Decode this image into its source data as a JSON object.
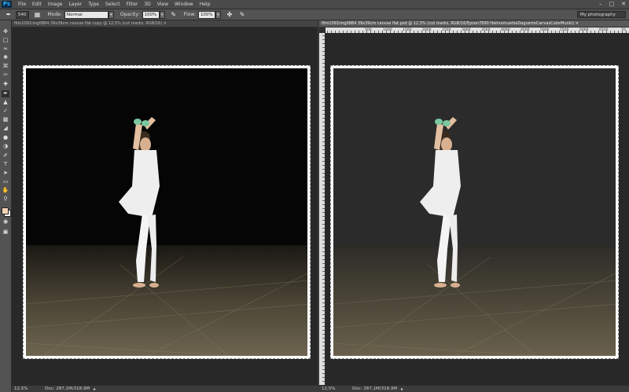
{
  "app": {
    "logo": "Ps"
  },
  "menu": [
    "File",
    "Edit",
    "Image",
    "Layer",
    "Type",
    "Select",
    "Filter",
    "3D",
    "View",
    "Window",
    "Help"
  ],
  "window_controls": [
    "–",
    "□",
    "✕"
  ],
  "options": {
    "brush_size": "540",
    "mode_label": "Mode:",
    "mode_value": "Normal",
    "opacity_label": "Opacity:",
    "opacity_value": "100%",
    "flow_label": "Flow:",
    "flow_value": "100%",
    "workspace": "My photography"
  },
  "tools": [
    "move-icon",
    "marquee-icon",
    "lasso-icon",
    "quick-select-icon",
    "crop-icon",
    "eyedropper-icon",
    "healing-icon",
    "brush-icon",
    "stamp-icon",
    "history-brush-icon",
    "eraser-icon",
    "gradient-icon",
    "blur-icon",
    "dodge-icon",
    "pen-icon",
    "type-icon",
    "path-select-icon",
    "shape-icon",
    "hand-icon",
    "zoom-icon"
  ],
  "documents": [
    {
      "tab": "film1091img0884 39x39cm canvas flat copy @ 12,5% (cut marks, RGB/16) ✕",
      "zoom": "12,5%",
      "doc_info": "Doc: 287,1M/318,9M",
      "dark": true
    },
    {
      "tab": "film1091img0884 39x39cm canvas flat.psd @ 12,5% (cut marks, RGB/16/Epson7890 HahnemuehleDaguerreCanvasColorMunki) ✕",
      "zoom": "12,5%",
      "doc_info": "Doc: 287,1M/318,9M",
      "ruler_numbers": [
        "500",
        "1000",
        "1500",
        "2000",
        "2500",
        "3000",
        "3500",
        "4000",
        "4500",
        "5000",
        "5500",
        "6000",
        "6500",
        "70"
      ],
      "dark": false
    }
  ],
  "colors": {
    "foreground": "#f3d3b5",
    "background": "#ffffff",
    "accent": "#2fb0ff"
  }
}
